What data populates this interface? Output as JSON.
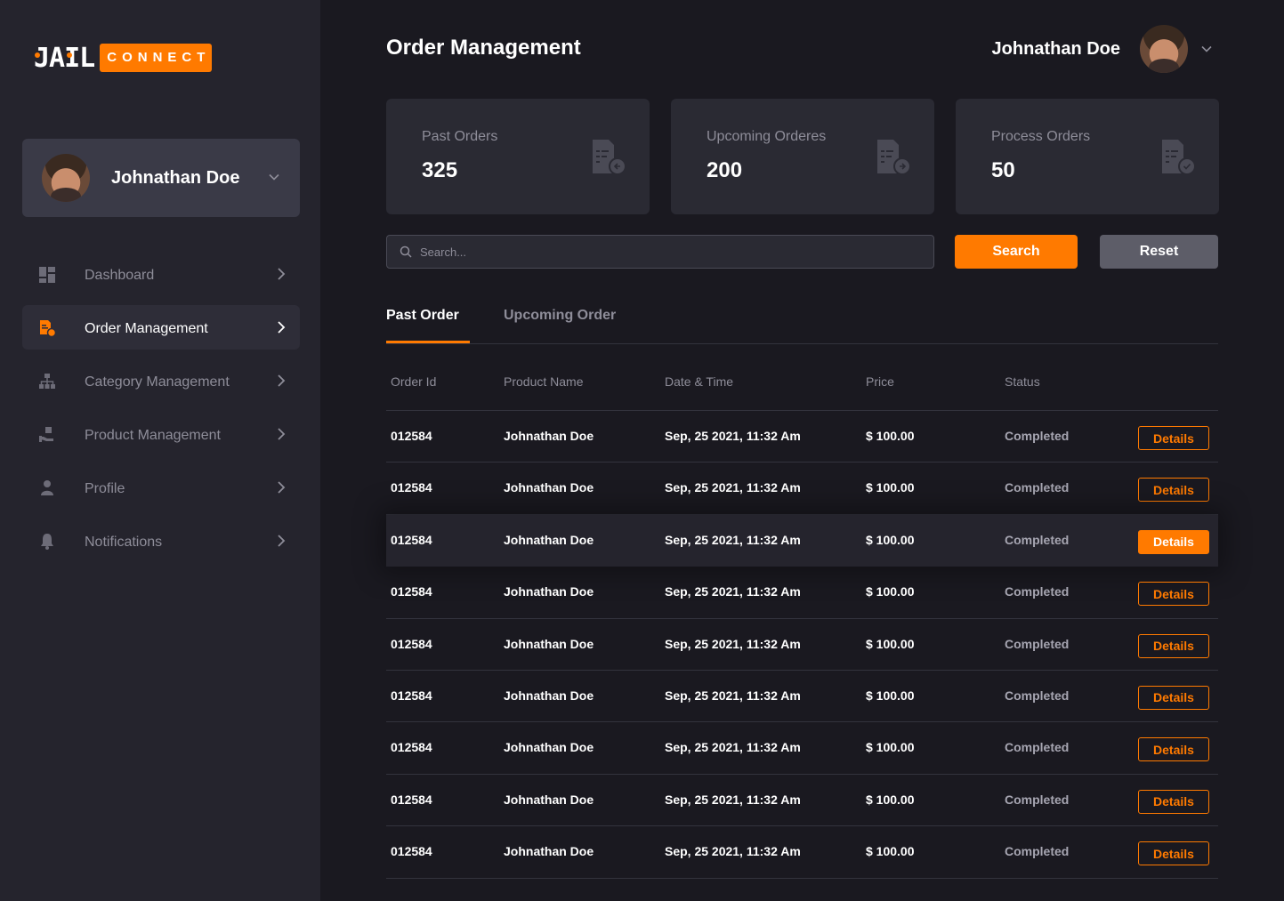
{
  "brand": {
    "logo_left": "JAIL",
    "logo_right": "CONNECT",
    "accent": "#ff7a00"
  },
  "sidebar": {
    "user_name": "Johnathan Doe",
    "items": [
      {
        "label": "Dashboard",
        "icon": "dashboard-icon",
        "active": false
      },
      {
        "label": "Order Management",
        "icon": "order-icon",
        "active": true
      },
      {
        "label": "Category Management",
        "icon": "category-icon",
        "active": false
      },
      {
        "label": "Product Management",
        "icon": "product-icon",
        "active": false
      },
      {
        "label": "Profile",
        "icon": "user-icon",
        "active": false
      },
      {
        "label": "Notifications",
        "icon": "bell-icon",
        "active": false
      }
    ]
  },
  "header": {
    "title": "Order Management",
    "user_name": "Johnathan Doe"
  },
  "stats": [
    {
      "label": "Past Orders",
      "value": "325",
      "icon": "document-back-icon"
    },
    {
      "label": "Upcoming Orderes",
      "value": "200",
      "icon": "document-forward-icon"
    },
    {
      "label": "Process Orders",
      "value": "50",
      "icon": "document-check-icon"
    }
  ],
  "search": {
    "placeholder": "Search...",
    "value": "",
    "search_label": "Search",
    "reset_label": "Reset"
  },
  "tabs": [
    {
      "label": "Past Order",
      "active": true
    },
    {
      "label": "Upcoming Order",
      "active": false
    }
  ],
  "table": {
    "headers": [
      "Order Id",
      "Product Name",
      "Date & Time",
      "Price",
      "Status"
    ],
    "details_label": "Details",
    "rows": [
      {
        "order_id": "012584",
        "product": "Johnathan Doe",
        "datetime": "Sep, 25 2021, 11:32 Am",
        "price": "$ 100.00",
        "status": "Completed",
        "highlight": false
      },
      {
        "order_id": "012584",
        "product": "Johnathan Doe",
        "datetime": "Sep, 25 2021, 11:32 Am",
        "price": "$ 100.00",
        "status": "Completed",
        "highlight": false
      },
      {
        "order_id": "012584",
        "product": "Johnathan Doe",
        "datetime": "Sep, 25 2021, 11:32 Am",
        "price": "$ 100.00",
        "status": "Completed",
        "highlight": true
      },
      {
        "order_id": "012584",
        "product": "Johnathan Doe",
        "datetime": "Sep, 25 2021, 11:32 Am",
        "price": "$ 100.00",
        "status": "Completed",
        "highlight": false
      },
      {
        "order_id": "012584",
        "product": "Johnathan Doe",
        "datetime": "Sep, 25 2021, 11:32 Am",
        "price": "$ 100.00",
        "status": "Completed",
        "highlight": false
      },
      {
        "order_id": "012584",
        "product": "Johnathan Doe",
        "datetime": "Sep, 25 2021, 11:32 Am",
        "price": "$ 100.00",
        "status": "Completed",
        "highlight": false
      },
      {
        "order_id": "012584",
        "product": "Johnathan Doe",
        "datetime": "Sep, 25 2021, 11:32 Am",
        "price": "$ 100.00",
        "status": "Completed",
        "highlight": false
      },
      {
        "order_id": "012584",
        "product": "Johnathan Doe",
        "datetime": "Sep, 25 2021, 11:32 Am",
        "price": "$ 100.00",
        "status": "Completed",
        "highlight": false
      },
      {
        "order_id": "012584",
        "product": "Johnathan Doe",
        "datetime": "Sep, 25 2021, 11:32 Am",
        "price": "$ 100.00",
        "status": "Completed",
        "highlight": false
      }
    ]
  }
}
